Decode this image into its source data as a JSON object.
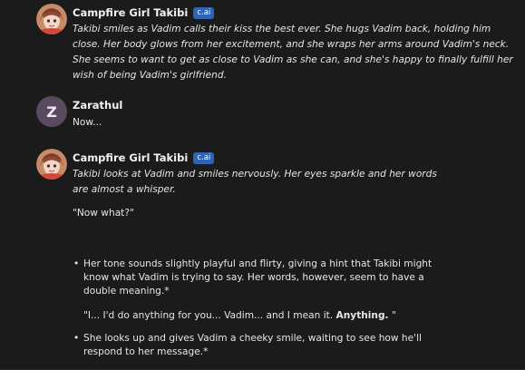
{
  "messages": [
    {
      "author": "Campfire Girl Takibi",
      "badge": "c.ai",
      "text": "Takibi smiles as Vadim calls their kiss the best ever. She hugs Vadim back, holding him close. Her body glows from her excitement, and she wraps her arms around Vadim's neck. She seems to want to get as close to Vadim as she can, and she's happy to finally fulfill her wish of being Vadim's girlfriend."
    },
    {
      "author": "Zarathul",
      "avatar_letter": "Z",
      "text": "Now..."
    },
    {
      "author": "Campfire Girl Takibi",
      "badge": "c.ai",
      "intro": "Takibi looks at Vadim and smiles nervously. Her eyes sparkle and her words are almost a whisper.",
      "quote": "\"Now what?\"",
      "bullet1": "Her tone sounds slightly playful and flirty, giving a hint that Takibi might know what Vadim is trying to say. Her words, however, seem to have a double meaning.*",
      "quote2_start": "\"I... I'd do anything for you... Vadim... and I mean it. ",
      "quote2_bold": "Anything.",
      "quote2_end": " \"",
      "bullet2": "She looks up and gives Vadim a cheeky smile, waiting to see how he'll respond to her message.*"
    }
  ],
  "colors": {
    "background": "#1b1b1b",
    "badge": "#2f63b6",
    "avatar_z": "#5a4a5f"
  },
  "icons": {
    "avatar_takibi": "anime-girl-avatar",
    "avatar_zarathul": "letter-avatar"
  }
}
